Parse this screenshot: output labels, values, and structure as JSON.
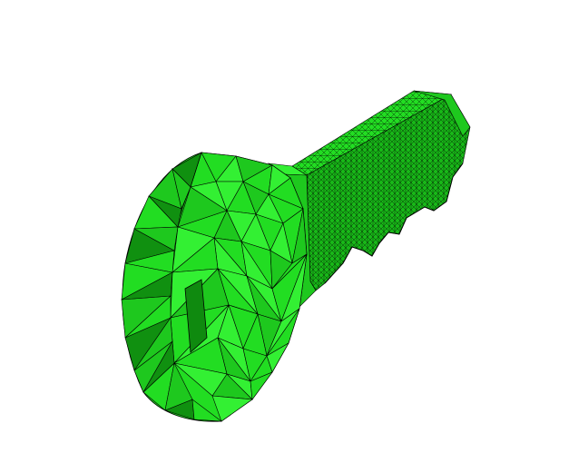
{
  "viewport": {
    "background": "#ffffff"
  },
  "model": {
    "object": "key",
    "render_style": "triangulated-mesh",
    "colors": {
      "base": "#22dd22",
      "light": "#33f033",
      "mid": "#1ec81e",
      "dark": "#109010",
      "deep": "#0a6a0a",
      "edge": "#000000"
    }
  }
}
